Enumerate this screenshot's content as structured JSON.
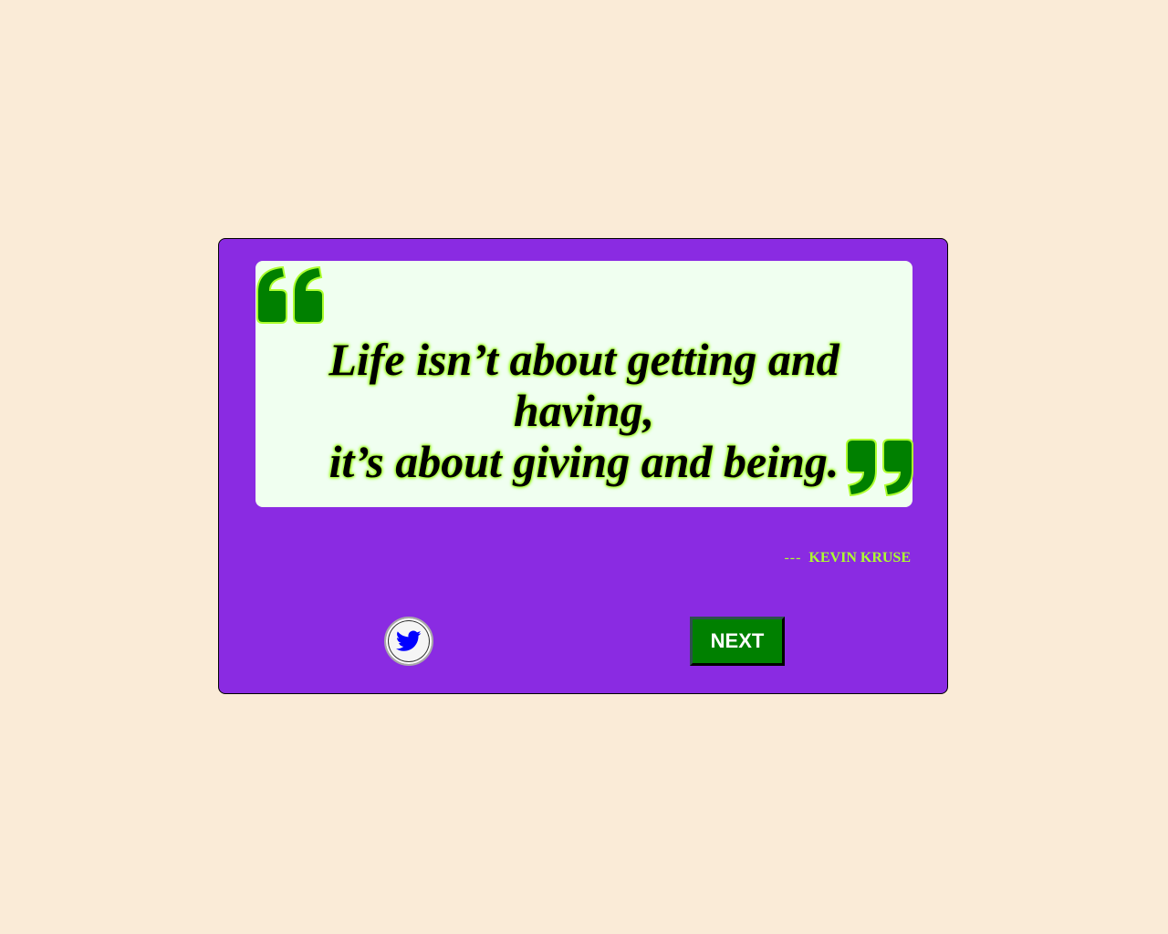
{
  "quote": {
    "text_line_1": "Life isn’t about getting and having,",
    "text_line_2": "it’s about giving and being.",
    "author_prefix": "---",
    "author": "KEVIN KRUSE"
  },
  "actions": {
    "tweet_icon": "twitter-bird-icon",
    "next_label": "NEXT"
  },
  "colors": {
    "background": "#faebd7",
    "card": "#8a2be2",
    "panel": "#f0fff0",
    "quote_marks": "#008000",
    "glow": "#adff2f",
    "next_button": "#008000",
    "tweet_icon": "#0000ff"
  }
}
